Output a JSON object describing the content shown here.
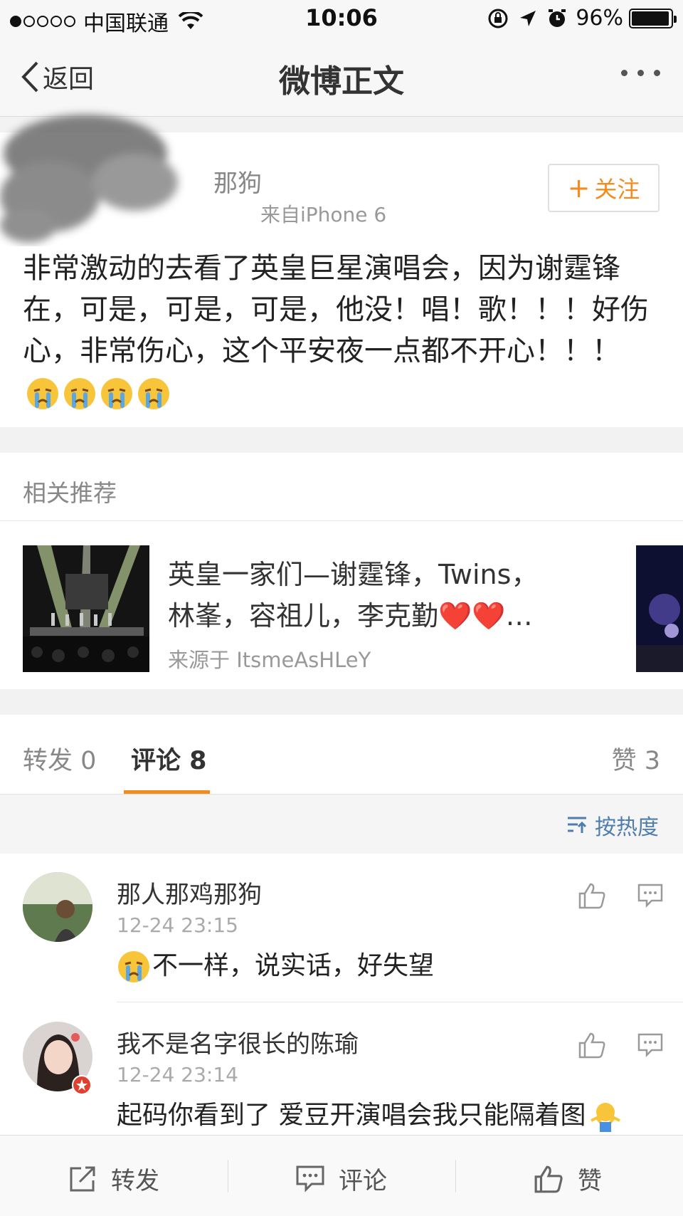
{
  "status_bar": {
    "carrier": "中国联通",
    "time": "10:06",
    "battery": "96%",
    "battery_level": 0.96
  },
  "nav": {
    "back_label": "返回",
    "title": "微博正文"
  },
  "post": {
    "author_name_visible": "那狗",
    "meta_visible": "来自iPhone 6",
    "follow_label": "关注",
    "text": "非常激动的去看了英皇巨星演唱会，因为谢霆锋在，可是，可是，可是，他没！唱！歌！！！好伤心，非常伤心，这个平安夜一点都不开心！！！",
    "emoji_count": 4,
    "emoji_name": "crying-face-icon"
  },
  "recommend": {
    "title": "相关推荐",
    "item_line1": "英皇一家们—谢霆锋，Twins，",
    "item_line2": "林峯，容祖儿，李克勤❤️❤️…",
    "source": "来源于 ItsmeAsHLeY"
  },
  "tabs": {
    "repost": "转发 0",
    "comment": "评论 8",
    "like": "赞 3"
  },
  "sort": {
    "label": "按热度"
  },
  "comments": [
    {
      "name": "那人那鸡那狗",
      "time": "12-24 23:15",
      "text": "不一样，说实话，好失望"
    },
    {
      "name": "我不是名字很长的陈瑜",
      "time": "12-24 23:14",
      "text": "起码你看到了 爱豆开演唱会我只能隔着图"
    }
  ],
  "bottom_bar": {
    "repost": "转发",
    "comment": "评论",
    "like": "赞"
  },
  "colors": {
    "accent": "#f28c1f",
    "link": "#507daf"
  }
}
